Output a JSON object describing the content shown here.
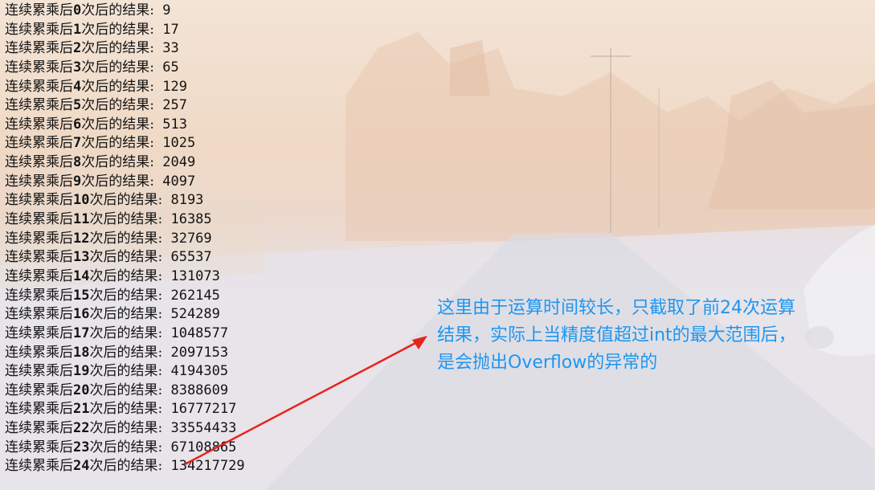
{
  "output_lines": [
    {
      "prefix": "连续累乘后",
      "n": "0",
      "suffix": "次后的结果:",
      "value": "9"
    },
    {
      "prefix": "连续累乘后",
      "n": "1",
      "suffix": "次后的结果:",
      "value": "17"
    },
    {
      "prefix": "连续累乘后",
      "n": "2",
      "suffix": "次后的结果:",
      "value": "33"
    },
    {
      "prefix": "连续累乘后",
      "n": "3",
      "suffix": "次后的结果:",
      "value": "65"
    },
    {
      "prefix": "连续累乘后",
      "n": "4",
      "suffix": "次后的结果:",
      "value": "129"
    },
    {
      "prefix": "连续累乘后",
      "n": "5",
      "suffix": "次后的结果:",
      "value": "257"
    },
    {
      "prefix": "连续累乘后",
      "n": "6",
      "suffix": "次后的结果:",
      "value": "513"
    },
    {
      "prefix": "连续累乘后",
      "n": "7",
      "suffix": "次后的结果:",
      "value": "1025"
    },
    {
      "prefix": "连续累乘后",
      "n": "8",
      "suffix": "次后的结果:",
      "value": "2049"
    },
    {
      "prefix": "连续累乘后",
      "n": "9",
      "suffix": "次后的结果:",
      "value": "4097"
    },
    {
      "prefix": "连续累乘后",
      "n": "10",
      "suffix": "次后的结果:",
      "value": "8193"
    },
    {
      "prefix": "连续累乘后",
      "n": "11",
      "suffix": "次后的结果:",
      "value": "16385"
    },
    {
      "prefix": "连续累乘后",
      "n": "12",
      "suffix": "次后的结果:",
      "value": "32769"
    },
    {
      "prefix": "连续累乘后",
      "n": "13",
      "suffix": "次后的结果:",
      "value": "65537"
    },
    {
      "prefix": "连续累乘后",
      "n": "14",
      "suffix": "次后的结果:",
      "value": "131073"
    },
    {
      "prefix": "连续累乘后",
      "n": "15",
      "suffix": "次后的结果:",
      "value": "262145"
    },
    {
      "prefix": "连续累乘后",
      "n": "16",
      "suffix": "次后的结果:",
      "value": "524289"
    },
    {
      "prefix": "连续累乘后",
      "n": "17",
      "suffix": "次后的结果:",
      "value": "1048577"
    },
    {
      "prefix": "连续累乘后",
      "n": "18",
      "suffix": "次后的结果:",
      "value": "2097153"
    },
    {
      "prefix": "连续累乘后",
      "n": "19",
      "suffix": "次后的结果:",
      "value": "4194305"
    },
    {
      "prefix": "连续累乘后",
      "n": "20",
      "suffix": "次后的结果:",
      "value": "8388609"
    },
    {
      "prefix": "连续累乘后",
      "n": "21",
      "suffix": "次后的结果:",
      "value": "16777217"
    },
    {
      "prefix": "连续累乘后",
      "n": "22",
      "suffix": "次后的结果:",
      "value": "33554433"
    },
    {
      "prefix": "连续累乘后",
      "n": "23",
      "suffix": "次后的结果:",
      "value": "67108865"
    },
    {
      "prefix": "连续累乘后",
      "n": "24",
      "suffix": "次后的结果:",
      "value": "134217729"
    }
  ],
  "annotation": {
    "lines": [
      "这里由于运算时间较长，只截取了前24次运算",
      "结果，实际上当精度值超过int的最大范围后，",
      "是会抛出Overflow的异常的"
    ],
    "color": "#1e96f0",
    "arrow_color": "#e8231c"
  },
  "background": {
    "description_icon": "desert-road-wallpaper"
  }
}
